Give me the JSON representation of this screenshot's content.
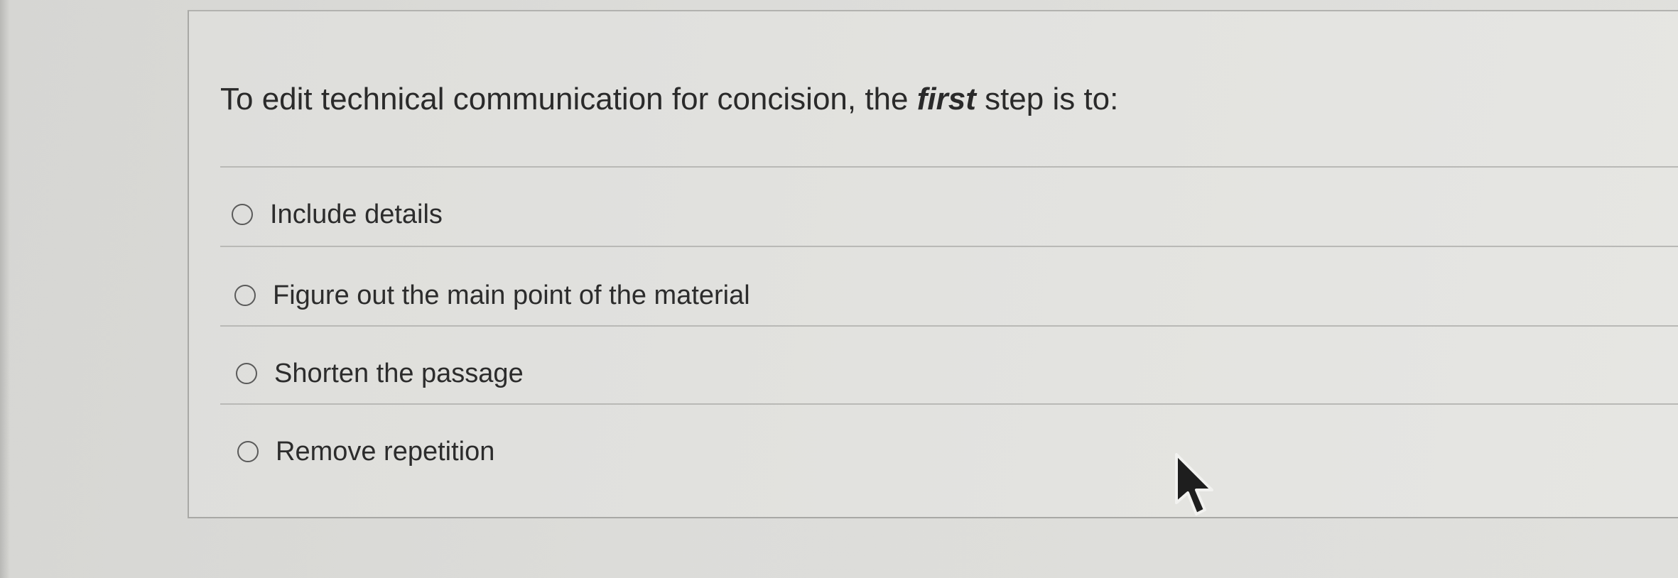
{
  "question": {
    "prefix": "To edit technical communication for concision, the ",
    "emphasis": "first",
    "suffix": " step is to:"
  },
  "options": [
    {
      "label": "Include details",
      "selected": false
    },
    {
      "label": "Figure out the main point of the material",
      "selected": false
    },
    {
      "label": "Shorten the passage",
      "selected": false
    },
    {
      "label": "Remove repetition",
      "selected": false
    }
  ],
  "icons": {
    "radio": "radio-unchecked-icon",
    "cursor": "mouse-pointer-icon"
  }
}
